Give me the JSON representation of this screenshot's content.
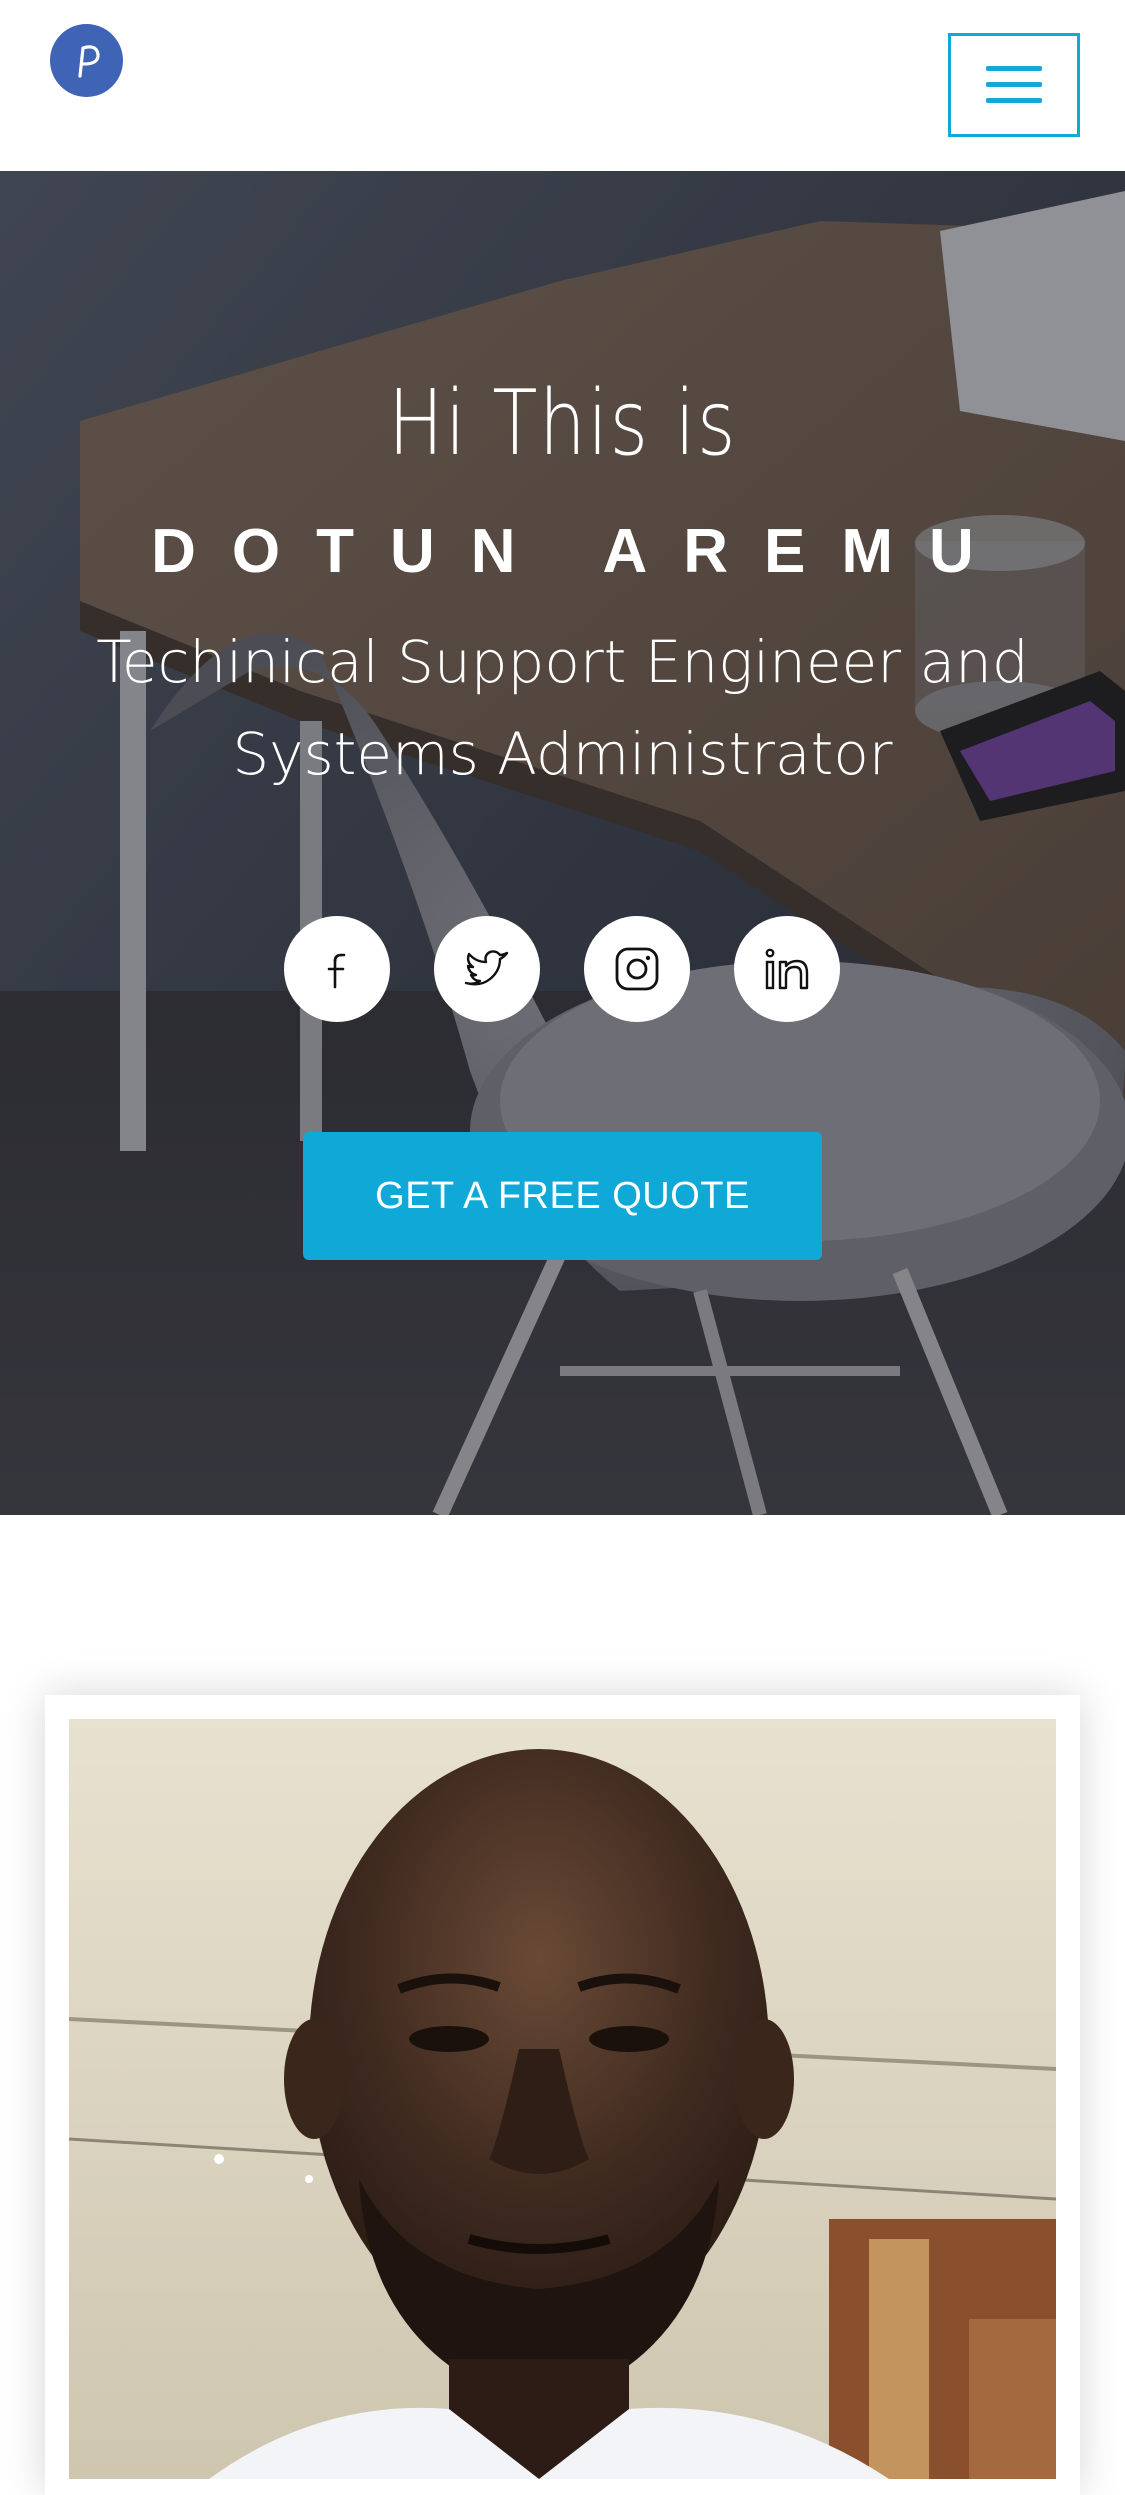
{
  "header": {
    "logo_icon": "p-logo-icon",
    "menu_icon": "hamburger-menu-icon",
    "accent_color": "#13a8d6"
  },
  "hero": {
    "greeting": "Hi This is",
    "name": "DOTUN AREMU",
    "role": "Techinical Support Engineer and Systems Administrator",
    "social_icons": [
      "facebook-icon",
      "twitter-icon",
      "instagram-icon",
      "linkedin-icon"
    ],
    "cta_label": "GET A FREE QUOTE",
    "cta_color": "#10a9d7"
  },
  "about": {
    "photo": "profile-photo"
  }
}
